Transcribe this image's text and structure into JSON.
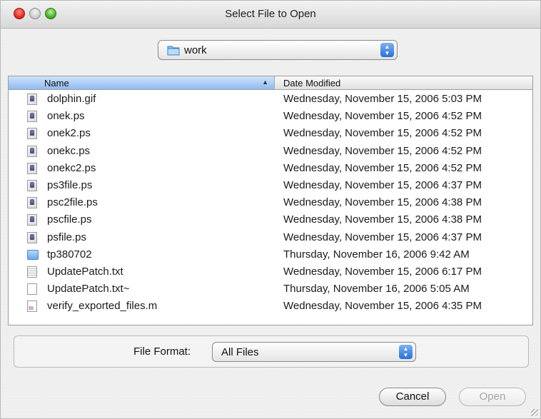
{
  "window": {
    "title": "Select File to Open"
  },
  "location": {
    "folder": "work",
    "folder_icon": "folder-icon"
  },
  "columns": {
    "name": "Name",
    "date": "Date Modified",
    "sort_indicator": "▲"
  },
  "files": [
    {
      "name": "dolphin.gif",
      "date": "Wednesday, November 15, 2006 5:03 PM",
      "icon": "ps"
    },
    {
      "name": "onek.ps",
      "date": "Wednesday, November 15, 2006 4:52 PM",
      "icon": "ps"
    },
    {
      "name": "onek2.ps",
      "date": "Wednesday, November 15, 2006 4:52 PM",
      "icon": "ps"
    },
    {
      "name": "onekc.ps",
      "date": "Wednesday, November 15, 2006 4:52 PM",
      "icon": "ps"
    },
    {
      "name": "onekc2.ps",
      "date": "Wednesday, November 15, 2006 4:52 PM",
      "icon": "ps"
    },
    {
      "name": "ps3file.ps",
      "date": "Wednesday, November 15, 2006 4:37 PM",
      "icon": "ps"
    },
    {
      "name": "psc2file.ps",
      "date": "Wednesday, November 15, 2006 4:38 PM",
      "icon": "ps"
    },
    {
      "name": "pscfile.ps",
      "date": "Wednesday, November 15, 2006 4:38 PM",
      "icon": "ps"
    },
    {
      "name": "psfile.ps",
      "date": "Wednesday, November 15, 2006 4:37 PM",
      "icon": "ps"
    },
    {
      "name": "tp380702",
      "date": "Thursday, November 16, 2006 9:42 AM",
      "icon": "folder"
    },
    {
      "name": "UpdatePatch.txt",
      "date": "Wednesday, November 15, 2006 6:17 PM",
      "icon": "txt"
    },
    {
      "name": "UpdatePatch.txt~",
      "date": "Thursday, November 16, 2006 5:05 AM",
      "icon": "blank"
    },
    {
      "name": "verify_exported_files.m",
      "date": "Wednesday, November 15, 2006 4:35 PM",
      "icon": "m"
    }
  ],
  "format": {
    "label": "File Format:",
    "value": "All Files"
  },
  "buttons": {
    "cancel": "Cancel",
    "open": "Open"
  },
  "colors": {
    "accent": "#2c6fd6",
    "header_selected": "#8fbaf2"
  }
}
